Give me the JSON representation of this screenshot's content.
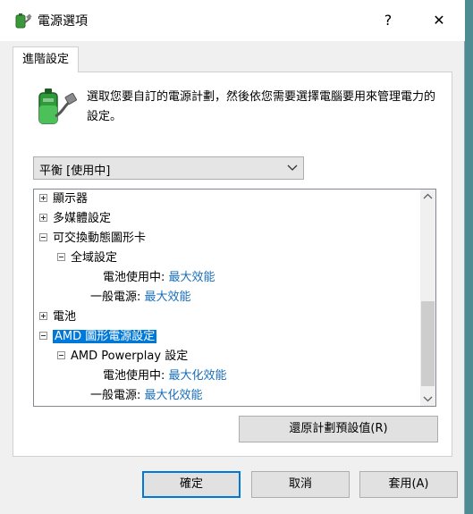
{
  "window": {
    "title": "電源選項",
    "help_label": "?",
    "close_label": "✕"
  },
  "tab": {
    "label": "進階設定"
  },
  "description": "選取您要自訂的電源計劃，然後依您需要選擇電腦要用來管理電力的設定。",
  "plan_select": {
    "value": "平衡 [使用中]"
  },
  "tree": {
    "items": [
      {
        "label": "顯示器",
        "value": ""
      },
      {
        "label": "多媒體設定",
        "value": ""
      },
      {
        "label": "可交換動態圖形卡",
        "value": ""
      },
      {
        "label": "全域設定",
        "value": ""
      },
      {
        "label": "電池使用中:",
        "value": "最大效能"
      },
      {
        "label": "一般電源:",
        "value": "最大效能"
      },
      {
        "label": "電池",
        "value": ""
      },
      {
        "label": "AMD 圖形電源設定",
        "value": ""
      },
      {
        "label": "AMD Powerplay 設定",
        "value": ""
      },
      {
        "label": "電池使用中:",
        "value": "最大化效能"
      },
      {
        "label": "一般電源:",
        "value": "最大化效能"
      }
    ]
  },
  "buttons": {
    "restore": "還原計劃預設值(R)",
    "ok": "確定",
    "cancel": "取消",
    "apply": "套用(A)"
  },
  "colors": {
    "accent": "#0078d7",
    "value_text": "#1a6fb8",
    "dialog_bg": "#f0f0f0"
  }
}
